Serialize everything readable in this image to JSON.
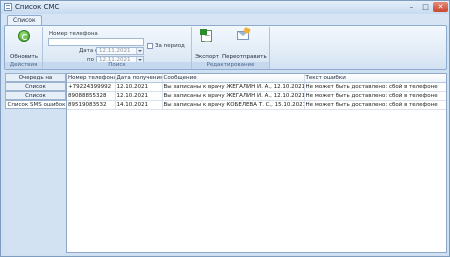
{
  "window": {
    "title": "Список СМС"
  },
  "ribbon": {
    "tab": "Список",
    "groups": {
      "actions": {
        "caption": "Действия",
        "refresh_label": "Обновить",
        "refresh_icon": "refresh-icon"
      },
      "search": {
        "caption": "Поиск",
        "phone_label": "Номер телефона",
        "phone_value": "",
        "date_from_label": "Дата с",
        "date_from_value": "12.11.2021",
        "date_to_label": "по",
        "date_to_value": "12.11.2021",
        "period_label": "За период",
        "period_checked": false
      },
      "edit": {
        "caption": "Редактирование",
        "export_label": "Экспорт",
        "export_icon": "excel-icon",
        "resend_label": "Переотправить",
        "resend_icon": "send-mail-icon"
      }
    }
  },
  "side_tabs": [
    {
      "label": "Очередь на отправку",
      "active": false
    },
    {
      "label": "Список отправленных",
      "active": false
    },
    {
      "label": "Список доставленных",
      "active": false
    },
    {
      "label": "Список SMS ошибок",
      "active": true
    }
  ],
  "table": {
    "columns": [
      "Номер телефона",
      "Дата получения ос",
      "Сообщение",
      "Текст ошибки"
    ],
    "rows": [
      [
        "+79224399992",
        "12.10.2021",
        "Вы записаны к врачу ЖЕГАЛИН И. А., 12.10.2021 числа, ...",
        "Не может быть доставлено: сбой в телефоне"
      ],
      [
        "89088855328",
        "12.10.2021",
        "Вы записаны к врачу ЖЕГАЛИН И. А., 12.10.2021 числа, ...",
        "Не может быть доставлено: сбой в телефоне"
      ],
      [
        "89519083532",
        "14.10.2021",
        "Вы записаны к врачу КОБЕЛЕВА Т. С., 15.10.2021 числа, ...",
        "Не может быть доставлено: сбой в телефоне"
      ]
    ]
  }
}
